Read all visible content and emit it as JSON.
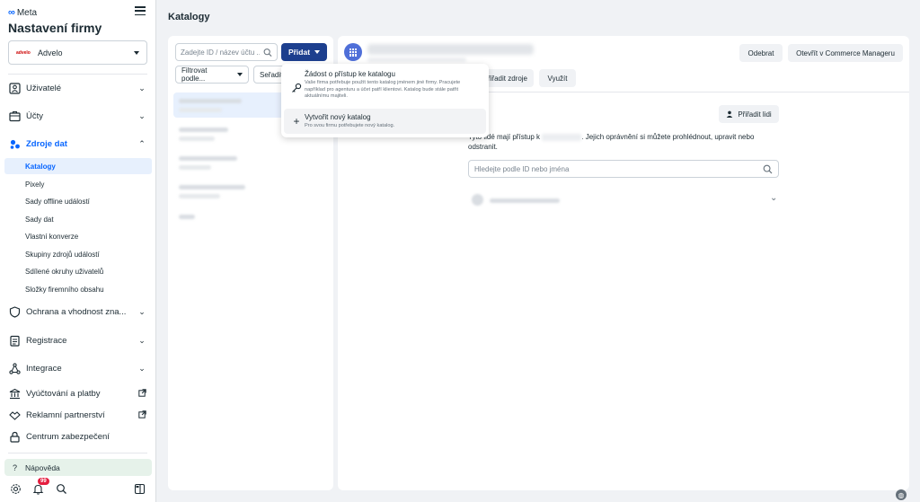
{
  "sidebar": {
    "logo_text": "Meta",
    "business_title": "Nastavení firmy",
    "business_select": {
      "badge": "advelo",
      "name": "Advelo"
    },
    "items": [
      {
        "label": "Uživatelé",
        "icon": "users-icon"
      },
      {
        "label": "Účty",
        "icon": "briefcase-icon"
      },
      {
        "label": "Zdroje dat",
        "icon": "data-sources-icon"
      },
      {
        "label": "Ochrana a vhodnost zna...",
        "icon": "shield-icon"
      },
      {
        "label": "Registrace",
        "icon": "clipboard-icon"
      },
      {
        "label": "Integrace",
        "icon": "integration-icon"
      },
      {
        "label": "Vyúčtování a platby",
        "icon": "bank-icon"
      },
      {
        "label": "Reklamní partnerství",
        "icon": "handshake-icon"
      },
      {
        "label": "Centrum zabezpečení",
        "icon": "lock-icon"
      }
    ],
    "subitems": [
      "Katalogy",
      "Pixely",
      "Sady offline událostí",
      "Sady dat",
      "Vlastní konverze",
      "Skupiny zdrojů událostí",
      "Sdílené okruhy uživatelů",
      "Složky firemního obsahu"
    ],
    "help_label": "Nápověda",
    "notification_count": "99"
  },
  "main": {
    "page_title": "Katalogy",
    "search_placeholder": "Zadejte ID / název účtu ...",
    "add_button": "Přidat",
    "filter_label": "Filtrovat podle...",
    "sort_label": "Seřadit"
  },
  "dropdown": {
    "items": [
      {
        "title": "Žádost o přístup ke katalogu",
        "desc": "Vaše firma potřebuje použít tento katalog jménem jiné firmy. Pracujete například pro agenturu a účet patří klientovi. Katalog bude stále patřit aktuálnímu majiteli."
      },
      {
        "title": "Vytvořit nový katalog",
        "desc": "Pro svou firmu potřebujete nový katalog."
      }
    ]
  },
  "detail": {
    "remove_button": "Odebrat",
    "open_commerce_button": "Otevřít v Commerce Manageru",
    "tab_assign_source": "řiřadit zdroje",
    "tab_use": "Využít",
    "assign_people_button": "Přiřadit lidi",
    "perm_text_a": "Tyto lidé mají přístup k",
    "perm_text_b": "Jejich oprávnění si můžete prohlédnout, upravit nebo odstranit.",
    "people_search_placeholder": "Hledejte podle ID nebo jména"
  }
}
